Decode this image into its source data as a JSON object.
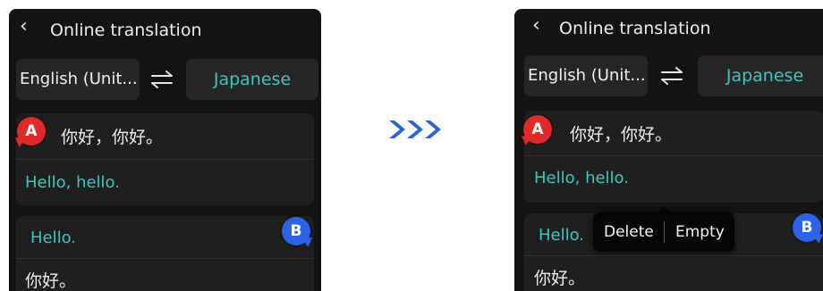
{
  "flow_arrow": "triple-chevron-right-icon",
  "colors": {
    "accent": "#3ec7c0",
    "badge_a": "#e02a2a",
    "badge_b": "#2d63e8",
    "flow_arrow": "#2b63d6"
  },
  "left_screen": {
    "header": {
      "back_icon": "back-chevron-icon",
      "back_glyph": "‹",
      "title": "Online translation"
    },
    "language_bar": {
      "source": "English (Unit...",
      "swap_icon": "swap-arrows-icon",
      "target": "Japanese"
    },
    "conversation": [
      {
        "speaker": "A",
        "source": "你好，你好。",
        "translation": "Hello, hello."
      },
      {
        "speaker": "B",
        "source": "你好。",
        "translation": "Hello."
      }
    ]
  },
  "right_screen": {
    "header": {
      "back_icon": "back-chevron-icon",
      "back_glyph": "‹",
      "title": "Online translation"
    },
    "language_bar": {
      "source": "English (Unit...",
      "swap_icon": "swap-arrows-icon",
      "target": "Japanese"
    },
    "conversation": [
      {
        "speaker": "A",
        "source": "你好，你好。",
        "translation": "Hello, hello."
      },
      {
        "speaker": "B",
        "source": "你好。",
        "translation": "Hello."
      }
    ],
    "context_menu": {
      "items": [
        "Delete",
        "Empty"
      ]
    }
  }
}
